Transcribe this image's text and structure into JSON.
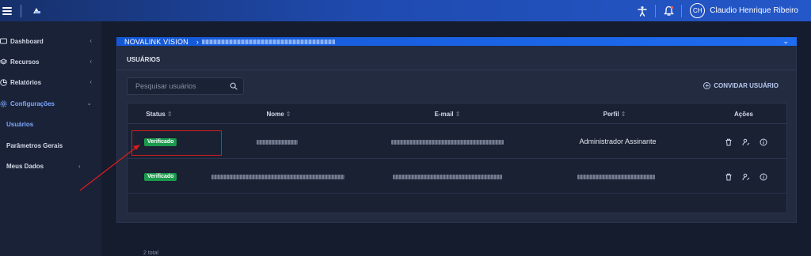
{
  "topbar": {
    "menu_icon": "hamburger-icon",
    "logo_icon": "app-logo-icon",
    "accessibility_icon": "accessibility-icon",
    "notification_icon": "bell-icon",
    "avatar_initials": "CH",
    "user_name": "Claudio Henrique Ribeiro"
  },
  "sidebar": {
    "items": [
      {
        "label": "Dashboard",
        "icon": "monitor-icon",
        "chevron": "‹"
      },
      {
        "label": "Recursos",
        "icon": "layers-icon",
        "chevron": "‹"
      },
      {
        "label": "Relatórios",
        "icon": "pie-chart-icon",
        "chevron": "‹"
      },
      {
        "label": "Configurações",
        "icon": "gear-icon",
        "chevron": "⌄"
      }
    ],
    "sub_items": [
      {
        "label": "Usuários",
        "active": true
      },
      {
        "label": "Parâmetros Gerais",
        "active": false
      },
      {
        "label": "Meus Dados",
        "active": false,
        "chevron": "‹"
      }
    ]
  },
  "breadcrumb": {
    "root": "NOVALINK VISION",
    "separator": "›",
    "collapse_icon": "⌄"
  },
  "panel": {
    "title": "USUÁRIOS",
    "search_placeholder": "Pesquisar usuários",
    "invite_label": "CONVIDAR USUÁRIO"
  },
  "table": {
    "headers": {
      "status": "Status",
      "nome": "Nome",
      "email": "E-mail",
      "perfil": "Perfil",
      "acoes": "Ações",
      "sort_glyph": "⇕"
    },
    "rows": [
      {
        "status": "Verificado",
        "perfil": "Administrador Assinante"
      },
      {
        "status": "Verificado",
        "perfil": ""
      }
    ],
    "total": "2 total"
  },
  "colors": {
    "accent": "#1f6cf0",
    "status_verified": "#1b9a4d",
    "annotation": "#d81c1c"
  }
}
